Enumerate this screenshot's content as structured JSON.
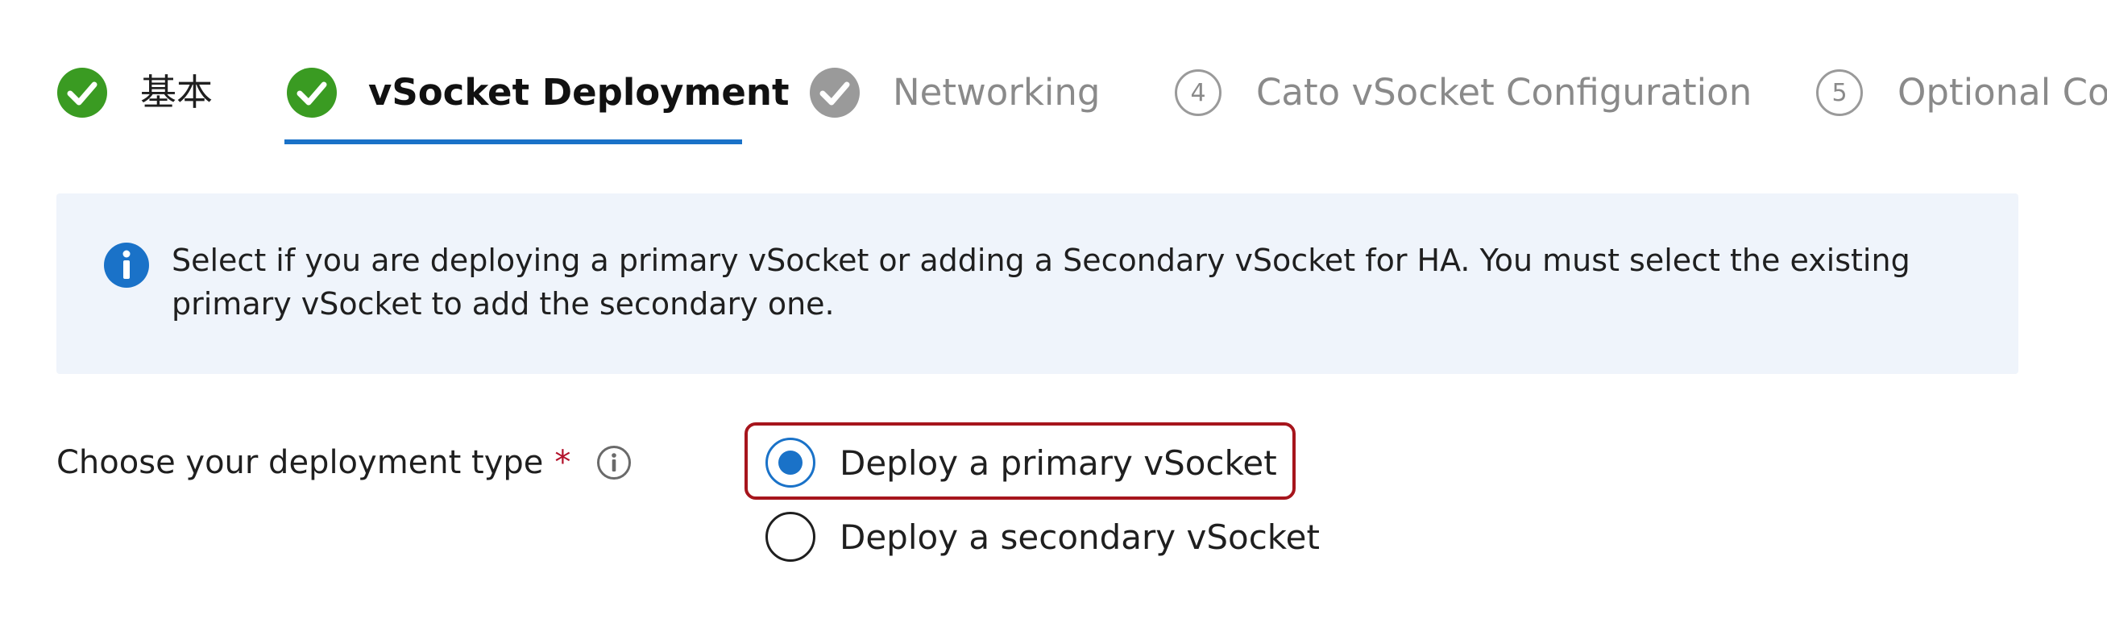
{
  "wizard": {
    "steps": [
      {
        "label": "基本",
        "state": "completed",
        "icon": "check-circle-icon"
      },
      {
        "label": "vSocket Deployment",
        "state": "active",
        "icon": "check-circle-icon"
      },
      {
        "label": "Networking",
        "state": "completed-muted",
        "icon": "check-circle-icon"
      },
      {
        "label": "Cato vSocket Configuration",
        "state": "upcoming",
        "number": "4"
      },
      {
        "label": "Optional Co",
        "state": "upcoming",
        "number": "5"
      }
    ]
  },
  "info_banner": {
    "icon": "info-icon",
    "text": "Select if you are deploying a primary vSocket or adding a Secondary vSocket for HA. You must select the existing primary vSocket to add the secondary one."
  },
  "form": {
    "deployment_type": {
      "label": "Choose your deployment type",
      "required_marker": "*",
      "help_icon": "info-outline-icon",
      "options": [
        {
          "label": "Deploy a primary vSocket",
          "selected": true
        },
        {
          "label": "Deploy a secondary vSocket",
          "selected": false
        }
      ]
    }
  },
  "colors": {
    "accent": "#1a72c8",
    "success": "#3a9b22",
    "muted_check": "#9a9a9a",
    "required": "#b3122b",
    "highlight_border": "#a6151c",
    "banner_bg": "#eff4fb"
  }
}
